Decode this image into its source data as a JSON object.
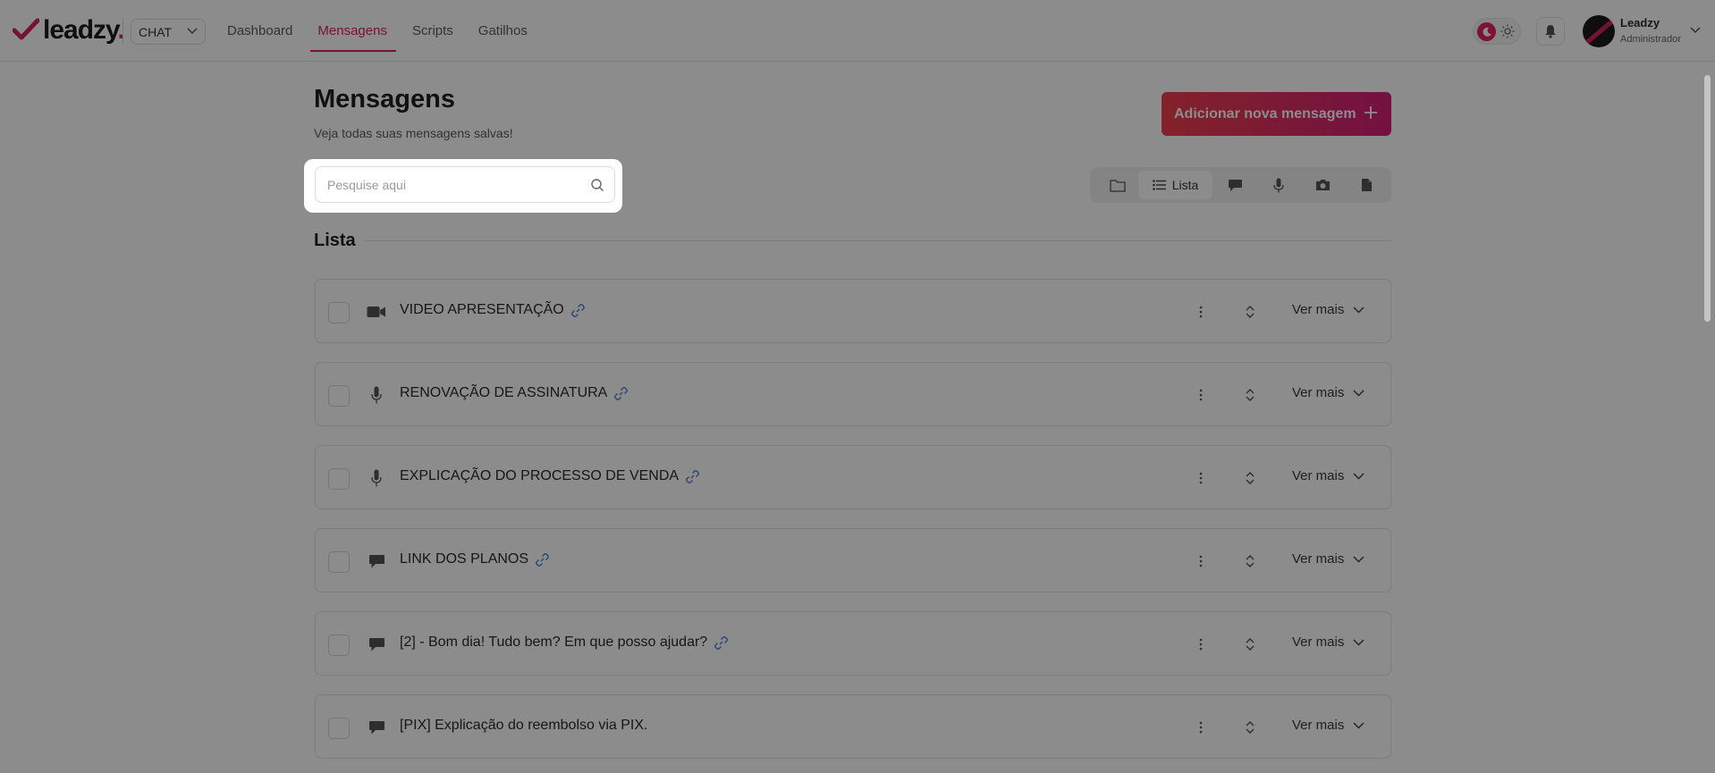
{
  "header": {
    "brand": "leadzy",
    "brand_dot": ".",
    "app_selector": "CHAT",
    "nav": [
      "Dashboard",
      "Mensagens",
      "Scripts",
      "Gatilhos"
    ],
    "active_nav": "Mensagens",
    "user_name": "Leadzy",
    "user_role": "Administrador"
  },
  "page": {
    "title": "Mensagens",
    "subtitle": "Veja todas suas mensagens salvas!",
    "add_button": "Adicionar nova mensagem",
    "search_placeholder": "Pesquise aqui",
    "view_switch": {
      "active_label": "Lista",
      "icons": [
        "folder-icon",
        "list-icon",
        "message-icon",
        "microphone-icon",
        "camera-icon",
        "document-icon"
      ]
    },
    "list_title": "Lista"
  },
  "messages": [
    {
      "title": "VIDEO APRESENTAÇÃO",
      "type": "video-icon",
      "linked": true,
      "more": "Ver mais"
    },
    {
      "title": "RENOVAÇÃO DE ASSINATURA",
      "type": "microphone-icon",
      "linked": true,
      "more": "Ver mais"
    },
    {
      "title": "EXPLICAÇÃO DO PROCESSO DE VENDA",
      "type": "microphone-icon",
      "linked": true,
      "more": "Ver mais"
    },
    {
      "title": "LINK DOS PLANOS",
      "type": "message-icon",
      "linked": true,
      "more": "Ver mais"
    },
    {
      "title": "[2] - Bom dia! Tudo bem? Em que posso ajudar?",
      "type": "message-icon",
      "linked": true,
      "more": "Ver mais"
    },
    {
      "title": "[PIX] Explicação do reembolso via PIX.",
      "type": "message-icon",
      "linked": false,
      "more": "Ver mais"
    }
  ],
  "colors": {
    "accent": "#d6245c",
    "button_gradient_start": "#ef3f4d",
    "button_gradient_end": "#d31f78",
    "link_icon": "#4a7fd6",
    "overlay": "rgba(0,0,0,0.45)"
  }
}
